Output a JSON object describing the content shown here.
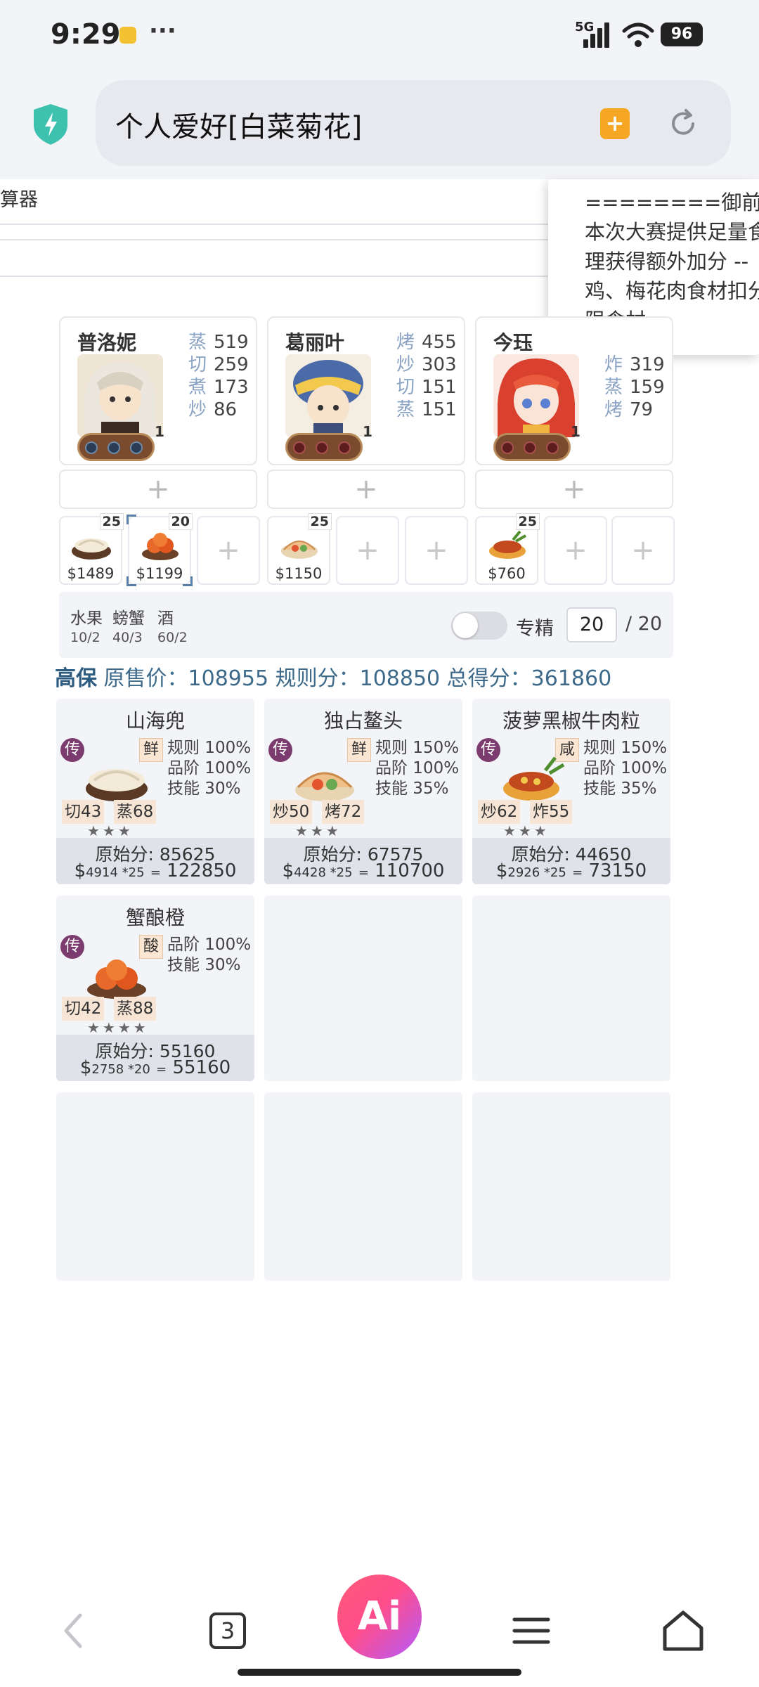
{
  "status_bar": {
    "time": "9:29",
    "dots": "···",
    "network": "5G",
    "battery": "96"
  },
  "browser": {
    "url_text": "个人爱好[白菜菊花]",
    "bookmark_icon": "bookmark-plus-icon",
    "reload_icon": "reload-icon"
  },
  "page": {
    "calc_label": "算器",
    "popup_lines": [
      "========御前大赛",
      "本次大赛提供足量食",
      "理获得额外加分 --",
      "鸡、梅花肉食材扣分",
      "限食材"
    ],
    "chefs": [
      {
        "name": "普洛妮",
        "level": "1",
        "skills": [
          {
            "n": "蒸",
            "v": "519"
          },
          {
            "n": "切",
            "v": "259"
          },
          {
            "n": "煮",
            "v": "173"
          },
          {
            "n": "炒",
            "v": "86"
          }
        ]
      },
      {
        "name": "葛丽叶",
        "level": "1",
        "skills": [
          {
            "n": "烤",
            "v": "455"
          },
          {
            "n": "炒",
            "v": "303"
          },
          {
            "n": "切",
            "v": "151"
          },
          {
            "n": "蒸",
            "v": "151"
          }
        ]
      },
      {
        "name": "今珏",
        "level": "1",
        "skills": [
          {
            "n": "炸",
            "v": "319"
          },
          {
            "n": "蒸",
            "v": "159"
          },
          {
            "n": "烤",
            "v": "79"
          }
        ]
      }
    ],
    "add_symbol": "+",
    "dish_slots": [
      {
        "price": "$1489",
        "qty": "25"
      },
      {
        "price": "$1199",
        "qty": "20"
      },
      {
        "price": "$1150",
        "qty": "25"
      },
      {
        "price": "$760",
        "qty": "25"
      }
    ],
    "conditions": [
      {
        "label": "水果",
        "val": "10/2"
      },
      {
        "label": "螃蟹",
        "val": "40/3"
      },
      {
        "label": "酒",
        "val": "60/2"
      }
    ],
    "spec_label": "专精",
    "qty_value": "20",
    "qty_max": "/ 20",
    "summary": {
      "prefix": "高保",
      "text": "原售价：108955 规则分：108850 总得分：361860"
    },
    "recipes": [
      {
        "name": "山海兜",
        "legend": "传",
        "flavor": "鲜",
        "bonus": [
          "规则 100%",
          "品阶 100%",
          "技能 30%"
        ],
        "req": [
          {
            "n": "切",
            "v": "43"
          },
          {
            "n": "蒸",
            "v": "68"
          }
        ],
        "stars": "★★★",
        "raw": "原始分: 85625",
        "calc_small": "4914 *25",
        "calc_total": "122850"
      },
      {
        "name": "独占鳌头",
        "legend": "传",
        "flavor": "鲜",
        "bonus": [
          "规则 150%",
          "品阶 100%",
          "技能 35%"
        ],
        "req": [
          {
            "n": "炒",
            "v": "50"
          },
          {
            "n": "烤",
            "v": "72"
          }
        ],
        "stars": "★★★",
        "raw": "原始分: 67575",
        "calc_small": "4428 *25",
        "calc_total": "110700"
      },
      {
        "name": "菠萝黑椒牛肉粒",
        "legend": "传",
        "flavor": "咸",
        "bonus": [
          "规则 150%",
          "品阶 100%",
          "技能 35%"
        ],
        "req": [
          {
            "n": "炒",
            "v": "62"
          },
          {
            "n": "炸",
            "v": "55"
          }
        ],
        "stars": "★★★",
        "raw": "原始分: 44650",
        "calc_small": "2926 *25",
        "calc_total": "73150"
      },
      {
        "name": "蟹酿橙",
        "legend": "传",
        "flavor": "酸",
        "bonus": [
          "品阶 100%",
          "技能 30%"
        ],
        "req": [
          {
            "n": "切",
            "v": "42"
          },
          {
            "n": "蒸",
            "v": "88"
          }
        ],
        "stars": "★★★★",
        "raw": "原始分: 55160",
        "calc_small": "2758 *20",
        "calc_total": "55160"
      }
    ],
    "equals": "=",
    "dollar": "$"
  },
  "nav": {
    "tab_count": "3",
    "ai_label": "Ai"
  },
  "colors": {
    "accent_blue": "#3d6a8a",
    "legend_purple": "#7b3b6e",
    "card_bg": "#f2f4f8",
    "ai_gradient_start": "#ff5b7a",
    "ai_gradient_end": "#b35bff"
  }
}
